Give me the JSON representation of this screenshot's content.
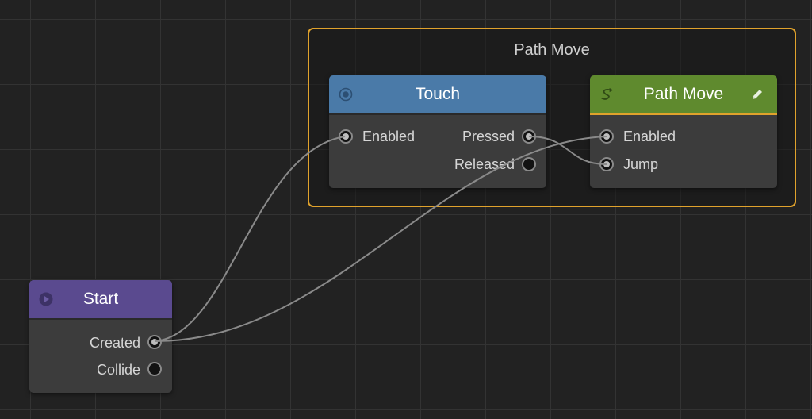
{
  "group": {
    "title": "Path Move"
  },
  "nodes": {
    "touch": {
      "title": "Touch",
      "header_color": "#4a7aa8",
      "icon": "target-icon",
      "inputs": [
        "Enabled"
      ],
      "outputs": [
        "Pressed",
        "Released"
      ]
    },
    "path_move": {
      "title": "Path Move",
      "header_color": "#5f8a2e",
      "accent_color": "#e0a22c",
      "icon": "path-icon",
      "edit_icon": "pencil-icon",
      "inputs": [
        "Enabled",
        "Jump"
      ]
    },
    "start": {
      "title": "Start",
      "header_color": "#5a4a8f",
      "icon": "play-icon",
      "outputs": [
        "Created",
        "Collide"
      ]
    }
  },
  "connections": [
    {
      "from": "Start.Created",
      "to": "Touch.Enabled"
    },
    {
      "from": "Start.Created",
      "to": "Path Move.Enabled"
    },
    {
      "from": "Touch.Pressed",
      "to": "Path Move.Jump"
    }
  ]
}
